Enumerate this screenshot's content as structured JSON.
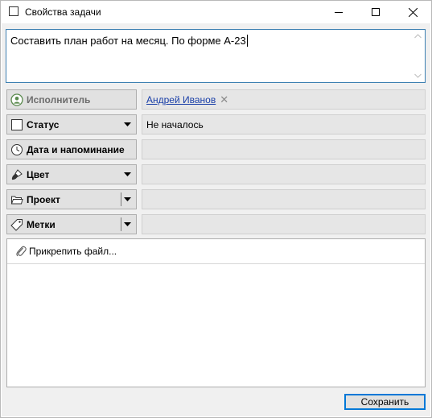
{
  "window": {
    "title": "Свойства задачи"
  },
  "task": {
    "text": "Составить план работ на месяц. По форме А-23"
  },
  "properties": {
    "assignee": {
      "label": "Исполнитель",
      "value": "Андрей Иванов",
      "remove_glyph": "✕"
    },
    "status": {
      "label": "Статус",
      "value": "Не началось"
    },
    "date": {
      "label": "Дата и напоминание",
      "value": ""
    },
    "color": {
      "label": "Цвет",
      "value": ""
    },
    "project": {
      "label": "Проект",
      "value": ""
    },
    "tags": {
      "label": "Метки",
      "value": ""
    }
  },
  "attachments": {
    "attach_label": "Прикрепить файл..."
  },
  "footer": {
    "save_label": "Сохранить"
  },
  "colors": {
    "accent": "#0078d7",
    "link": "#1a3fa8",
    "panel_bg": "#f0f0f0"
  }
}
